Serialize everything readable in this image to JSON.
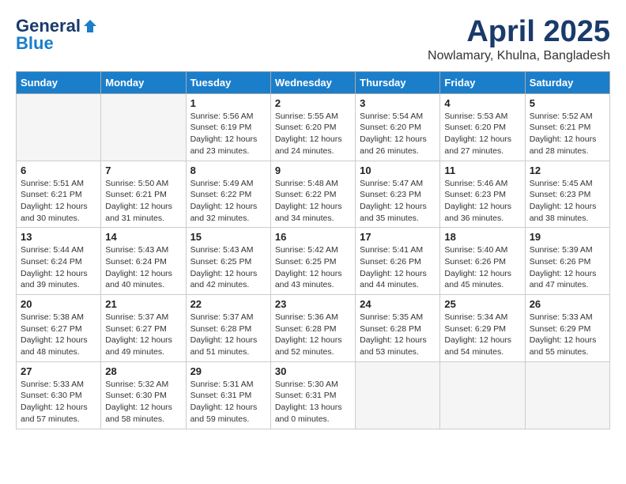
{
  "logo": {
    "general": "General",
    "blue": "Blue"
  },
  "title": "April 2025",
  "location": "Nowlamary, Khulna, Bangladesh",
  "days_header": [
    "Sunday",
    "Monday",
    "Tuesday",
    "Wednesday",
    "Thursday",
    "Friday",
    "Saturday"
  ],
  "weeks": [
    [
      {
        "day": "",
        "info": ""
      },
      {
        "day": "",
        "info": ""
      },
      {
        "day": "1",
        "info": "Sunrise: 5:56 AM\nSunset: 6:19 PM\nDaylight: 12 hours and 23 minutes."
      },
      {
        "day": "2",
        "info": "Sunrise: 5:55 AM\nSunset: 6:20 PM\nDaylight: 12 hours and 24 minutes."
      },
      {
        "day": "3",
        "info": "Sunrise: 5:54 AM\nSunset: 6:20 PM\nDaylight: 12 hours and 26 minutes."
      },
      {
        "day": "4",
        "info": "Sunrise: 5:53 AM\nSunset: 6:20 PM\nDaylight: 12 hours and 27 minutes."
      },
      {
        "day": "5",
        "info": "Sunrise: 5:52 AM\nSunset: 6:21 PM\nDaylight: 12 hours and 28 minutes."
      }
    ],
    [
      {
        "day": "6",
        "info": "Sunrise: 5:51 AM\nSunset: 6:21 PM\nDaylight: 12 hours and 30 minutes."
      },
      {
        "day": "7",
        "info": "Sunrise: 5:50 AM\nSunset: 6:21 PM\nDaylight: 12 hours and 31 minutes."
      },
      {
        "day": "8",
        "info": "Sunrise: 5:49 AM\nSunset: 6:22 PM\nDaylight: 12 hours and 32 minutes."
      },
      {
        "day": "9",
        "info": "Sunrise: 5:48 AM\nSunset: 6:22 PM\nDaylight: 12 hours and 34 minutes."
      },
      {
        "day": "10",
        "info": "Sunrise: 5:47 AM\nSunset: 6:23 PM\nDaylight: 12 hours and 35 minutes."
      },
      {
        "day": "11",
        "info": "Sunrise: 5:46 AM\nSunset: 6:23 PM\nDaylight: 12 hours and 36 minutes."
      },
      {
        "day": "12",
        "info": "Sunrise: 5:45 AM\nSunset: 6:23 PM\nDaylight: 12 hours and 38 minutes."
      }
    ],
    [
      {
        "day": "13",
        "info": "Sunrise: 5:44 AM\nSunset: 6:24 PM\nDaylight: 12 hours and 39 minutes."
      },
      {
        "day": "14",
        "info": "Sunrise: 5:43 AM\nSunset: 6:24 PM\nDaylight: 12 hours and 40 minutes."
      },
      {
        "day": "15",
        "info": "Sunrise: 5:43 AM\nSunset: 6:25 PM\nDaylight: 12 hours and 42 minutes."
      },
      {
        "day": "16",
        "info": "Sunrise: 5:42 AM\nSunset: 6:25 PM\nDaylight: 12 hours and 43 minutes."
      },
      {
        "day": "17",
        "info": "Sunrise: 5:41 AM\nSunset: 6:26 PM\nDaylight: 12 hours and 44 minutes."
      },
      {
        "day": "18",
        "info": "Sunrise: 5:40 AM\nSunset: 6:26 PM\nDaylight: 12 hours and 45 minutes."
      },
      {
        "day": "19",
        "info": "Sunrise: 5:39 AM\nSunset: 6:26 PM\nDaylight: 12 hours and 47 minutes."
      }
    ],
    [
      {
        "day": "20",
        "info": "Sunrise: 5:38 AM\nSunset: 6:27 PM\nDaylight: 12 hours and 48 minutes."
      },
      {
        "day": "21",
        "info": "Sunrise: 5:37 AM\nSunset: 6:27 PM\nDaylight: 12 hours and 49 minutes."
      },
      {
        "day": "22",
        "info": "Sunrise: 5:37 AM\nSunset: 6:28 PM\nDaylight: 12 hours and 51 minutes."
      },
      {
        "day": "23",
        "info": "Sunrise: 5:36 AM\nSunset: 6:28 PM\nDaylight: 12 hours and 52 minutes."
      },
      {
        "day": "24",
        "info": "Sunrise: 5:35 AM\nSunset: 6:28 PM\nDaylight: 12 hours and 53 minutes."
      },
      {
        "day": "25",
        "info": "Sunrise: 5:34 AM\nSunset: 6:29 PM\nDaylight: 12 hours and 54 minutes."
      },
      {
        "day": "26",
        "info": "Sunrise: 5:33 AM\nSunset: 6:29 PM\nDaylight: 12 hours and 55 minutes."
      }
    ],
    [
      {
        "day": "27",
        "info": "Sunrise: 5:33 AM\nSunset: 6:30 PM\nDaylight: 12 hours and 57 minutes."
      },
      {
        "day": "28",
        "info": "Sunrise: 5:32 AM\nSunset: 6:30 PM\nDaylight: 12 hours and 58 minutes."
      },
      {
        "day": "29",
        "info": "Sunrise: 5:31 AM\nSunset: 6:31 PM\nDaylight: 12 hours and 59 minutes."
      },
      {
        "day": "30",
        "info": "Sunrise: 5:30 AM\nSunset: 6:31 PM\nDaylight: 13 hours and 0 minutes."
      },
      {
        "day": "",
        "info": ""
      },
      {
        "day": "",
        "info": ""
      },
      {
        "day": "",
        "info": ""
      }
    ]
  ]
}
